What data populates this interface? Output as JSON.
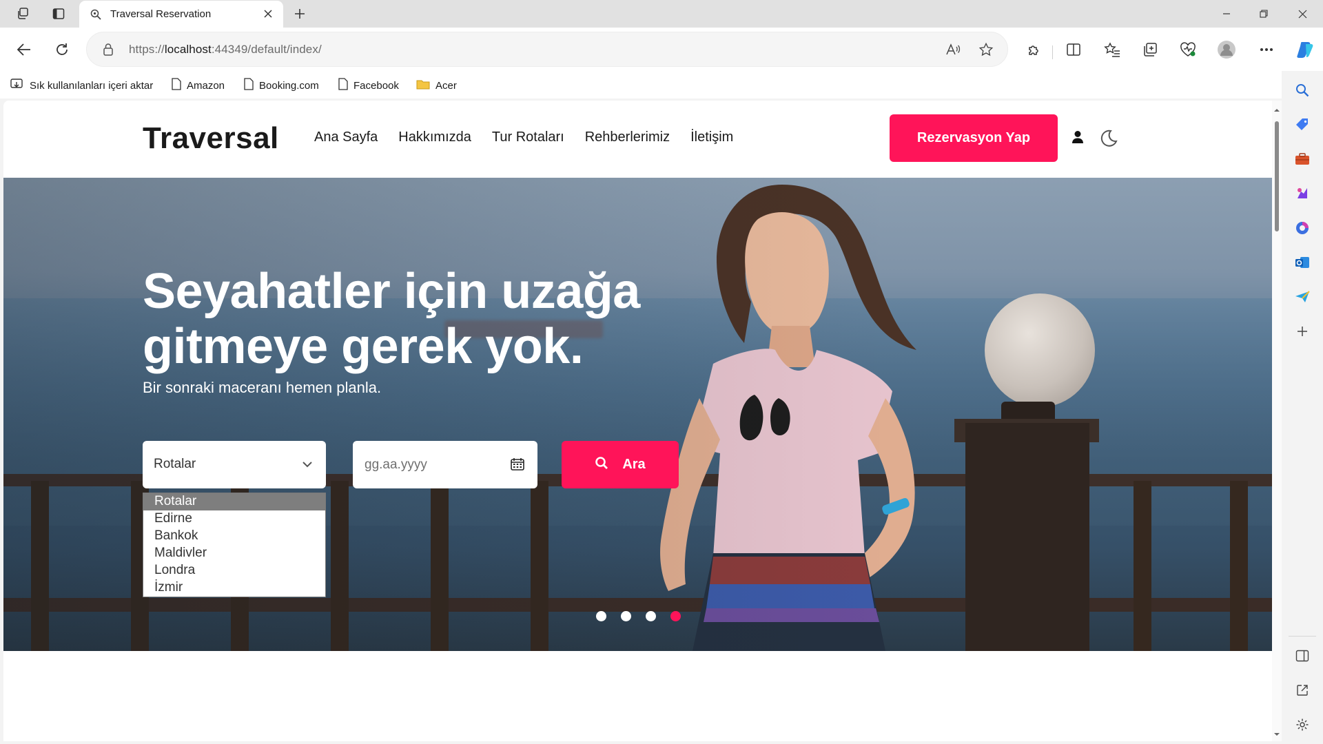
{
  "browser": {
    "tab": {
      "title": "Traversal Reservation"
    },
    "url": {
      "prefix": "https://",
      "host": "localhost",
      "rest": ":44349/default/index/"
    },
    "bookmarks": [
      {
        "label": "Sık kullanılanları içeri aktar",
        "icon": "import-favorites-icon"
      },
      {
        "label": "Amazon",
        "icon": "page-icon"
      },
      {
        "label": "Booking.com",
        "icon": "page-icon"
      },
      {
        "label": "Facebook",
        "icon": "page-icon"
      },
      {
        "label": "Acer",
        "icon": "folder-icon"
      }
    ]
  },
  "site": {
    "logo": "Traversal",
    "nav": [
      "Ana Sayfa",
      "Hakkımızda",
      "Tur Rotaları",
      "Rehberlerimiz",
      "İletişim"
    ],
    "cta_label": "Rezervasyon Yap"
  },
  "hero": {
    "title": "Seyahatler için uzağa gitmeye gerek yok.",
    "subtitle": "Bir sonraki maceranı hemen planla.",
    "route_select": {
      "selected": "Rotalar",
      "options": [
        "Rotalar",
        "Edirne",
        "Bankok",
        "Maldivler",
        "Londra",
        "İzmir"
      ]
    },
    "date_placeholder": "gg.aa.yyyy",
    "search_label": "Ara",
    "carousel": {
      "slides": 4,
      "active_index": 3
    }
  },
  "colors": {
    "accent": "#ff1459"
  }
}
